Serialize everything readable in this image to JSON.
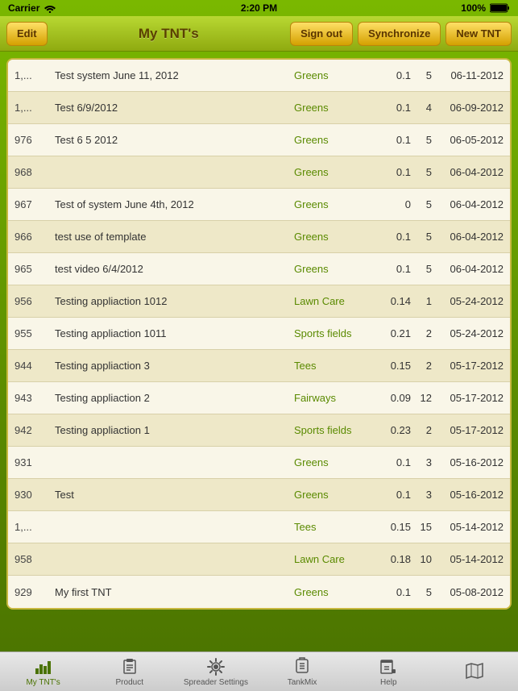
{
  "statusBar": {
    "carrier": "Carrier",
    "time": "2:20 PM",
    "battery": "100%"
  },
  "navBar": {
    "title": "My TNT's",
    "editBtn": "Edit",
    "signOutBtn": "Sign out",
    "syncBtn": "Synchronize",
    "newBtn": "New TNT"
  },
  "tableRows": [
    {
      "id": "1,...",
      "name": "Test system June 11, 2012",
      "category": "Greens",
      "num1": "0.1",
      "num2": "5",
      "date": "06-11-2012"
    },
    {
      "id": "1,...",
      "name": "Test 6/9/2012",
      "category": "Greens",
      "num1": "0.1",
      "num2": "4",
      "date": "06-09-2012"
    },
    {
      "id": "976",
      "name": "Test 6 5 2012",
      "category": "Greens",
      "num1": "0.1",
      "num2": "5",
      "date": "06-05-2012"
    },
    {
      "id": "968",
      "name": "",
      "category": "Greens",
      "num1": "0.1",
      "num2": "5",
      "date": "06-04-2012"
    },
    {
      "id": "967",
      "name": "Test of system June 4th, 2012",
      "category": "Greens",
      "num1": "0",
      "num2": "5",
      "date": "06-04-2012"
    },
    {
      "id": "966",
      "name": "test use of template",
      "category": "Greens",
      "num1": "0.1",
      "num2": "5",
      "date": "06-04-2012"
    },
    {
      "id": "965",
      "name": "test video 6/4/2012",
      "category": "Greens",
      "num1": "0.1",
      "num2": "5",
      "date": "06-04-2012"
    },
    {
      "id": "956",
      "name": "Testing appliaction 1012",
      "category": "Lawn Care",
      "num1": "0.14",
      "num2": "1",
      "date": "05-24-2012"
    },
    {
      "id": "955",
      "name": "Testing appliaction 1011",
      "category": "Sports fields",
      "num1": "0.21",
      "num2": "2",
      "date": "05-24-2012"
    },
    {
      "id": "944",
      "name": "Testing appliaction 3",
      "category": "Tees",
      "num1": "0.15",
      "num2": "2",
      "date": "05-17-2012"
    },
    {
      "id": "943",
      "name": "Testing appliaction 2",
      "category": "Fairways",
      "num1": "0.09",
      "num2": "12",
      "date": "05-17-2012"
    },
    {
      "id": "942",
      "name": "Testing appliaction 1",
      "category": "Sports fields",
      "num1": "0.23",
      "num2": "2",
      "date": "05-17-2012"
    },
    {
      "id": "931",
      "name": "",
      "category": "Greens",
      "num1": "0.1",
      "num2": "3",
      "date": "05-16-2012"
    },
    {
      "id": "930",
      "name": "Test",
      "category": "Greens",
      "num1": "0.1",
      "num2": "3",
      "date": "05-16-2012"
    },
    {
      "id": "1,...",
      "name": "",
      "category": "Tees",
      "num1": "0.15",
      "num2": "15",
      "date": "05-14-2012"
    },
    {
      "id": "958",
      "name": "",
      "category": "Lawn Care",
      "num1": "0.18",
      "num2": "10",
      "date": "05-14-2012"
    },
    {
      "id": "929",
      "name": "My first TNT",
      "category": "Greens",
      "num1": "0.1",
      "num2": "5",
      "date": "05-08-2012"
    }
  ],
  "tabBar": {
    "items": [
      {
        "id": "my-tnts",
        "label": "My TNT's",
        "active": true
      },
      {
        "id": "product",
        "label": "Product",
        "active": false
      },
      {
        "id": "spreader-settings",
        "label": "Spreader Settings",
        "active": false
      },
      {
        "id": "tankmix",
        "label": "TankMix",
        "active": false
      },
      {
        "id": "help",
        "label": "Help",
        "active": false
      },
      {
        "id": "map",
        "label": "",
        "active": false
      }
    ]
  }
}
